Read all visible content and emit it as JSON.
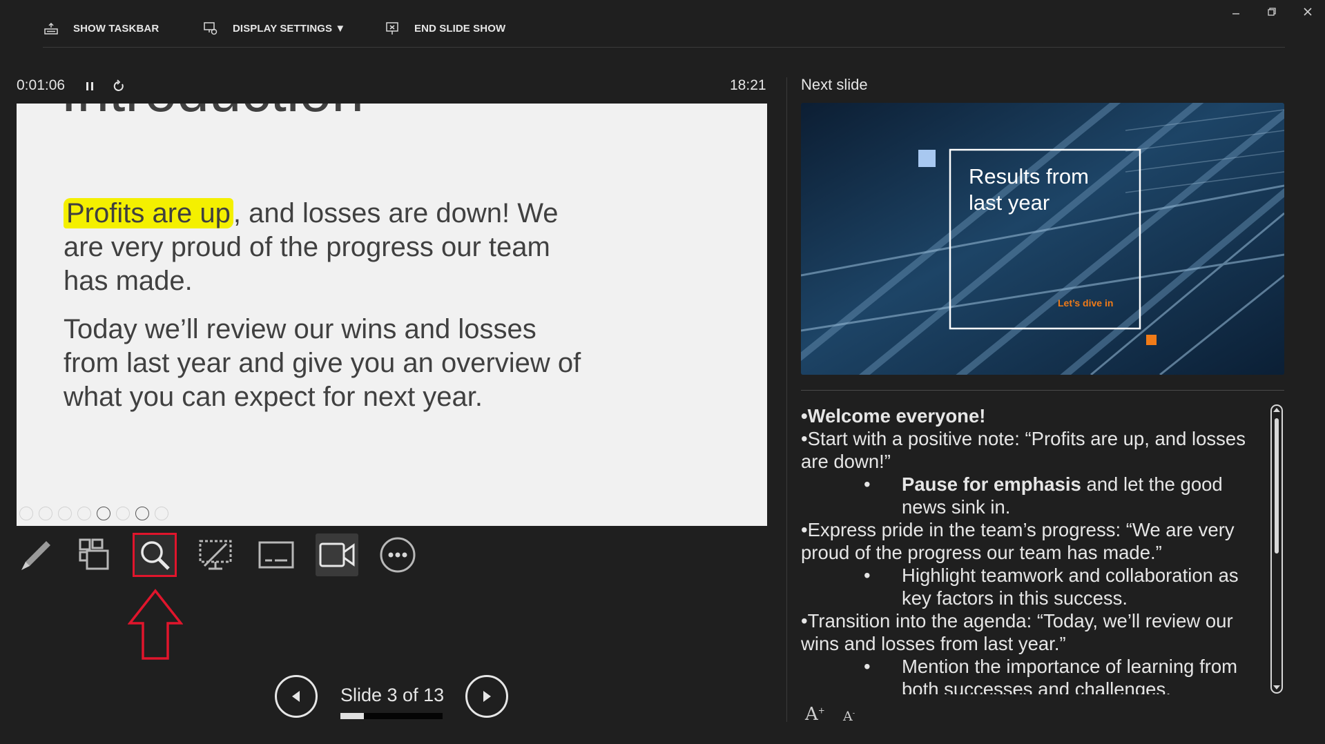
{
  "topbar": {
    "show_taskbar": "SHOW TASKBAR",
    "display_settings": "DISPLAY SETTINGS ▼",
    "end_slide_show": "END SLIDE SHOW"
  },
  "timer": {
    "elapsed": "0:01:06",
    "clock": "18:21"
  },
  "slide": {
    "title": "Introduction",
    "highlight": "Profits are up",
    "para1_rest": ", and losses are down! We are very proud of the progress our team has made.",
    "para2": "Today we’ll review our wins and losses from last year and give you an overview of what you can expect for next year."
  },
  "tools": [
    "pen-tool",
    "see-all-slides",
    "zoom-into-slide",
    "black-or-unblack-slide",
    "toggle-subtitles",
    "camera",
    "more-options"
  ],
  "navigation": {
    "slide_label": "Slide 3 of 13",
    "current": 3,
    "total": 13
  },
  "next_slide": {
    "label": "Next slide",
    "title": "Results from last year",
    "subtitle": "Let’s dive in"
  },
  "notes": {
    "line1": "•Welcome everyone!",
    "line2": "•Start with a positive note: “Profits are up, and losses are down!”",
    "line3_bold": "Pause for emphasis",
    "line3_rest": " and let the good news sink in.",
    "line4": "•Express pride in the team’s progress: “We are very proud of the progress our team has made.”",
    "line5": "Highlight teamwork and collaboration as key factors in this success.",
    "line6": "•Transition into the agenda: “Today, we’ll review our wins and losses from last year.”",
    "line7": "Mention the importance of learning from both successes and challenges."
  },
  "colors": {
    "background": "#1f1f1f",
    "highlight": "#f4f000",
    "annotation_red": "#e0152c",
    "accent_orange": "#f07b18"
  }
}
